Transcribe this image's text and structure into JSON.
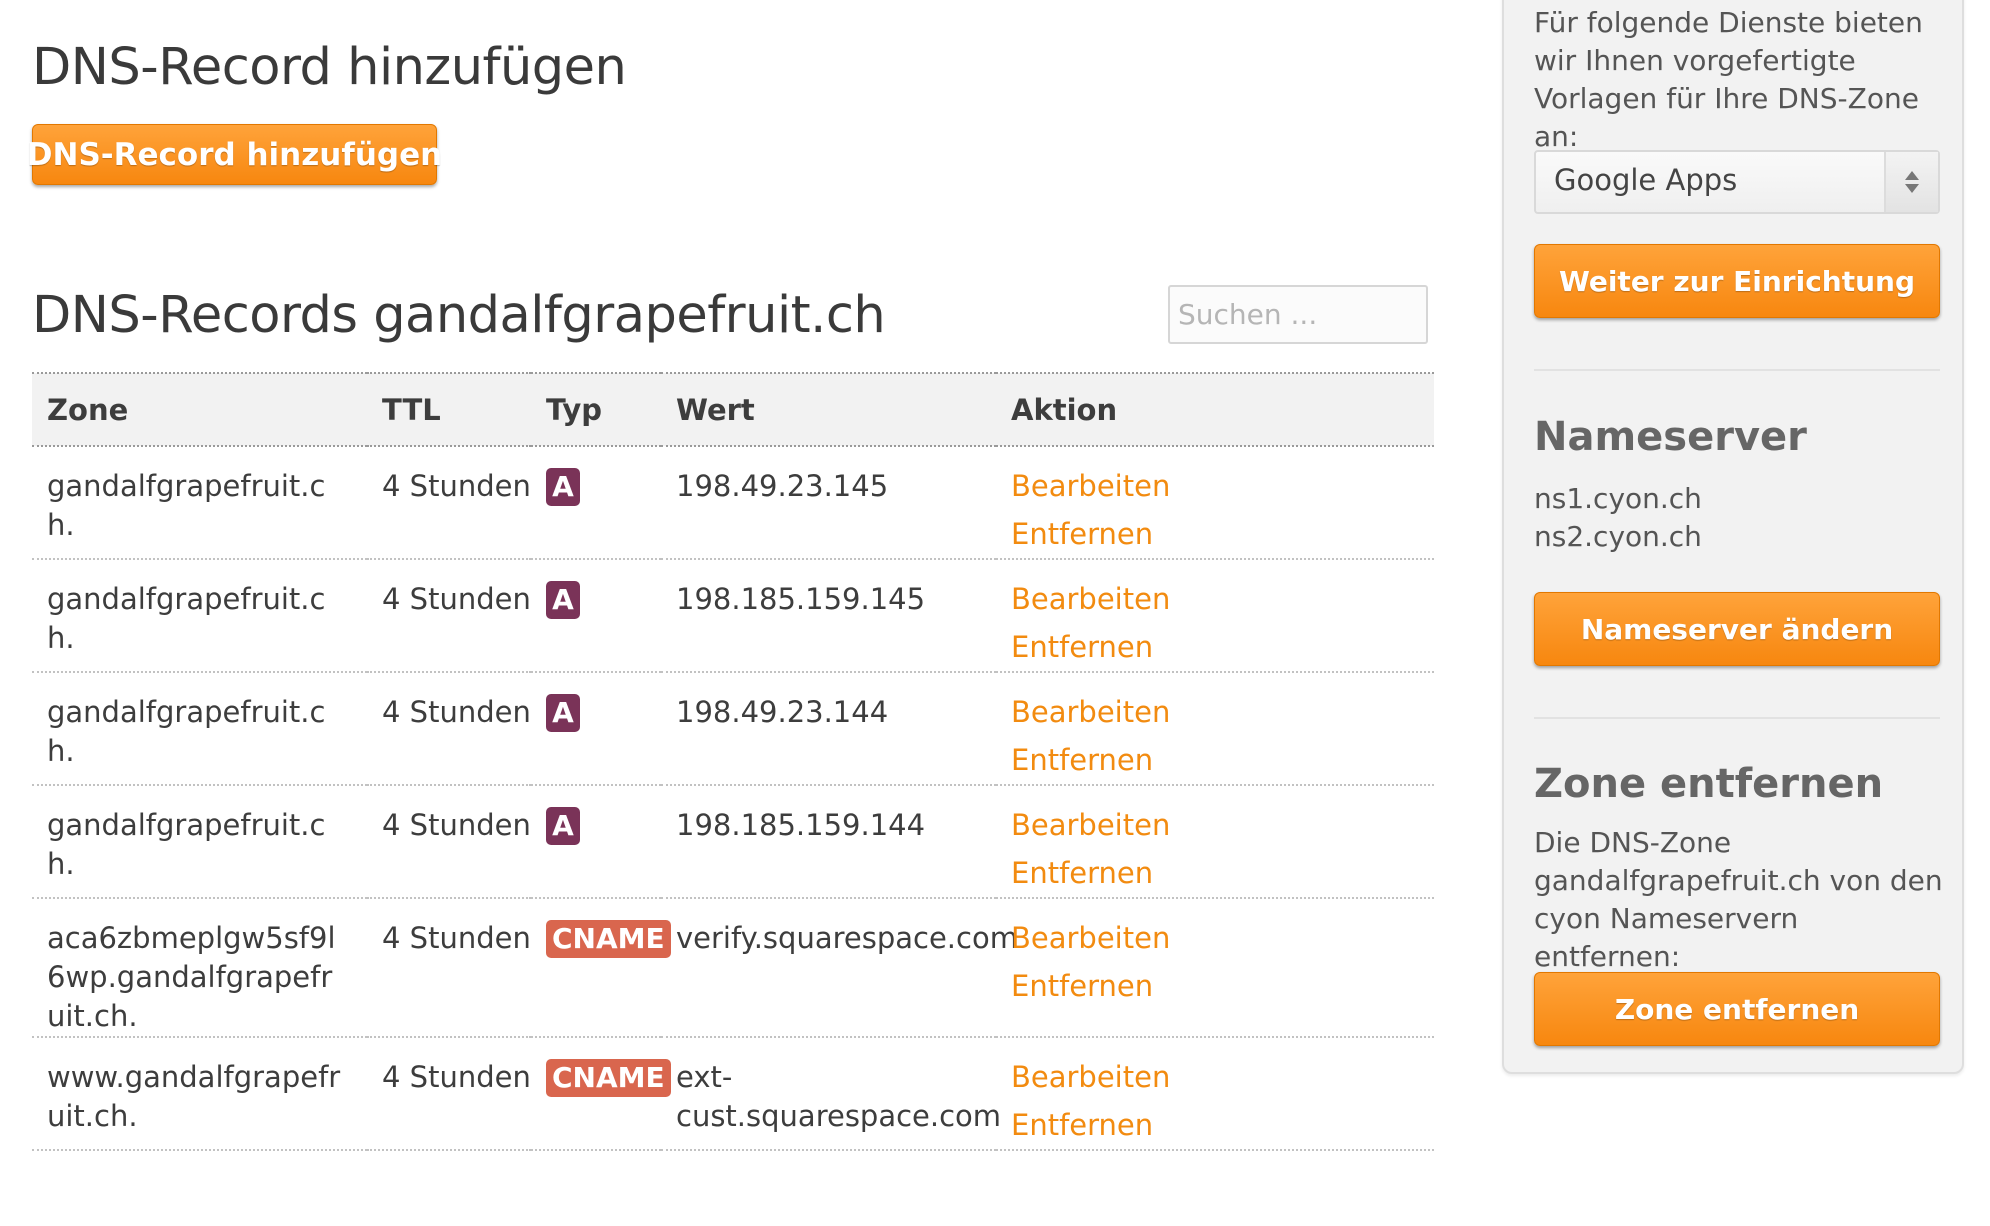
{
  "main": {
    "add_heading": "DNS-Record hinzufügen",
    "add_button": "DNS-Record hinzufügen",
    "records_heading": "DNS-Records gandalfgrapefruit.ch",
    "search_placeholder": "Suchen ...",
    "columns": [
      "Zone",
      "TTL",
      "Typ",
      "Wert",
      "Aktion"
    ],
    "rows": [
      {
        "zone": "gandalfgrapefruit.ch.",
        "ttl": "4 Stunden",
        "type": "A",
        "value": "198.49.23.145",
        "edit": "Bearbeiten",
        "remove": "Entfernen"
      },
      {
        "zone": "gandalfgrapefruit.ch.",
        "ttl": "4 Stunden",
        "type": "A",
        "value": "198.185.159.145",
        "edit": "Bearbeiten",
        "remove": "Entfernen"
      },
      {
        "zone": "gandalfgrapefruit.ch.",
        "ttl": "4 Stunden",
        "type": "A",
        "value": "198.49.23.144",
        "edit": "Bearbeiten",
        "remove": "Entfernen"
      },
      {
        "zone": "gandalfgrapefruit.ch.",
        "ttl": "4 Stunden",
        "type": "A",
        "value": "198.185.159.144",
        "edit": "Bearbeiten",
        "remove": "Entfernen"
      },
      {
        "zone": "aca6zbmeplgw5sf9l6wp.gandalfgrapefruit.ch.",
        "ttl": "4 Stunden",
        "type": "CNAME",
        "value": "verify.squarespace.com",
        "edit": "Bearbeiten",
        "remove": "Entfernen"
      },
      {
        "zone": "www.gandalfgrapefruit.ch.",
        "ttl": "4 Stunden",
        "type": "CNAME",
        "value": "ext-cust.squarespace.com",
        "edit": "Bearbeiten",
        "remove": "Entfernen"
      }
    ]
  },
  "sidebar": {
    "templates_intro": "Für folgende Dienste bieten wir Ihnen vorgefertigte Vorlagen für Ihre DNS-Zone an:",
    "template_select": "Google Apps",
    "template_button": "Weiter zur Einrichtung",
    "nameserver_heading": "Nameserver",
    "nameservers": [
      "ns1.cyon.ch",
      "ns2.cyon.ch"
    ],
    "nameserver_button": "Nameserver ändern",
    "zone_heading": "Zone entfernen",
    "zone_text": "Die DNS-Zone gandalfgrapefruit.ch von den cyon Nameservern entfernen:",
    "zone_button": "Zone entfernen"
  },
  "colors": {
    "accent_orange": "#f7870f",
    "type_a_badge": "#7a3358",
    "type_cname_badge": "#d9664e",
    "sidebar_bg": "#f2f2f2"
  }
}
